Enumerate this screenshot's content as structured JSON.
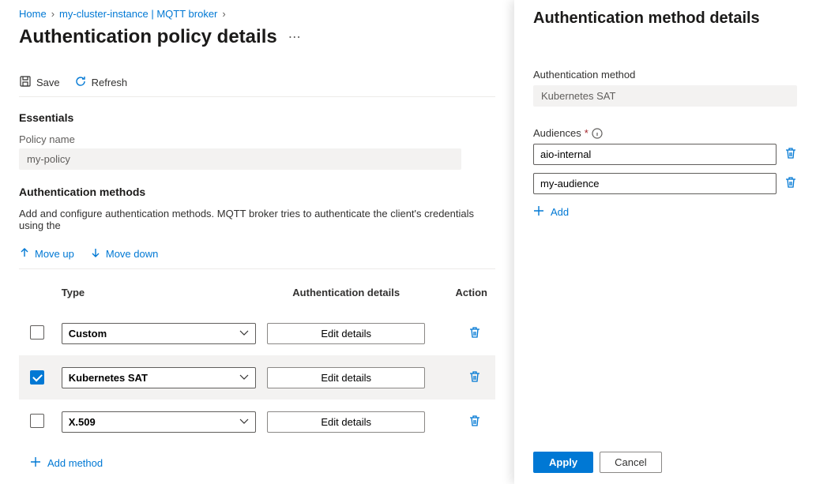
{
  "breadcrumb": {
    "home": "Home",
    "cluster": "my-cluster-instance | MQTT broker"
  },
  "page_title": "Authentication policy details",
  "toolbar": {
    "save": "Save",
    "refresh": "Refresh"
  },
  "essentials": {
    "heading": "Essentials",
    "policy_name_label": "Policy name",
    "policy_name_value": "my-policy"
  },
  "auth_methods": {
    "heading": "Authentication methods",
    "description": "Add and configure authentication methods. MQTT broker tries to authenticate the client's credentials using the",
    "move_up": "Move up",
    "move_down": "Move down",
    "columns": {
      "type": "Type",
      "details": "Authentication details",
      "action": "Action"
    },
    "rows": [
      {
        "type": "Custom",
        "details_btn": "Edit details",
        "checked": false
      },
      {
        "type": "Kubernetes SAT",
        "details_btn": "Edit details",
        "checked": true
      },
      {
        "type": "X.509",
        "details_btn": "Edit details",
        "checked": false
      }
    ],
    "add_method": "Add method"
  },
  "panel": {
    "title": "Authentication method details",
    "method_label": "Authentication method",
    "method_value": "Kubernetes SAT",
    "audiences_label": "Audiences",
    "audiences": [
      "aio-internal",
      "my-audience"
    ],
    "add": "Add",
    "apply": "Apply",
    "cancel": "Cancel"
  }
}
